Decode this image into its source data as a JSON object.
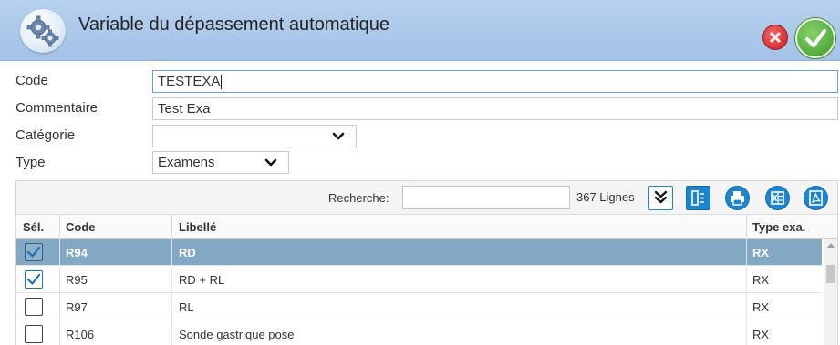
{
  "window": {
    "title": "Variable du dépassement automatique",
    "icon": "gears-icon",
    "close_icon": "close-icon",
    "validate_icon": "check-icon",
    "colors": {
      "titlebar": "#a9c7ea",
      "close": "#d7262c",
      "validate": "#58b23d",
      "selected_row": "#82a8c3",
      "toolbar_accent": "#1d84cf"
    }
  },
  "form": {
    "code_label": "Code",
    "code_value": "TESTEXA",
    "comment_label": "Commentaire",
    "comment_value": "Test Exa",
    "category_label": "Catégorie",
    "category_value": "",
    "type_label": "Type",
    "type_value": "Examens"
  },
  "toolbar": {
    "search_label": "Recherche:",
    "search_value": "",
    "line_count": "367 Lignes",
    "icons": [
      "double-chevron-down-icon",
      "columns-icon",
      "print-icon",
      "excel-export-icon",
      "pdf-export-icon"
    ]
  },
  "grid": {
    "columns": [
      "Sél.",
      "Code",
      "Libellé",
      "Type exa."
    ],
    "rows": [
      {
        "selected": true,
        "checked": true,
        "code": "R94",
        "label": "RD",
        "type": "RX"
      },
      {
        "selected": false,
        "checked": true,
        "code": "R95",
        "label": "RD + RL",
        "type": "RX"
      },
      {
        "selected": false,
        "checked": false,
        "code": "R97",
        "label": "RL",
        "type": "RX"
      },
      {
        "selected": false,
        "checked": false,
        "code": "R106",
        "label": "Sonde gastrique pose",
        "type": "RX"
      }
    ]
  }
}
